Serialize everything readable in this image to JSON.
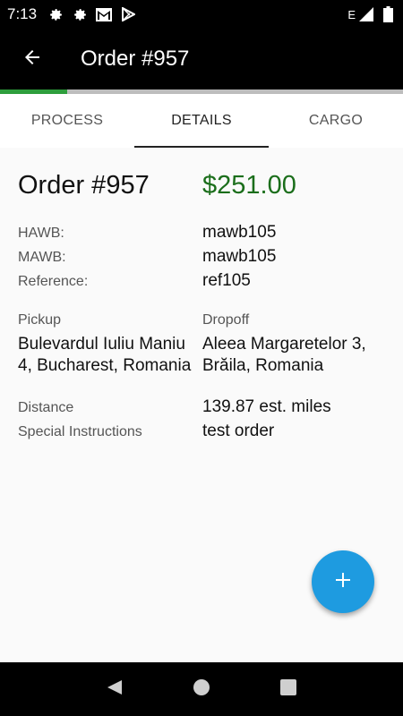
{
  "status_bar": {
    "time": "7:13",
    "network_label": "E",
    "icons": [
      "settings-icon",
      "settings-icon",
      "gmail-icon",
      "play-store-icon",
      "signal-icon",
      "battery-icon"
    ]
  },
  "app_bar": {
    "title": "Order #957",
    "back_icon": "arrow-left-icon"
  },
  "progress": {
    "fraction": 0.167,
    "color": "#2e9e3c"
  },
  "tabs": [
    {
      "label": "PROCESS",
      "active": false
    },
    {
      "label": "DETAILS",
      "active": true
    },
    {
      "label": "CARGO",
      "active": false
    }
  ],
  "order": {
    "number": "Order #957",
    "price": "$251.00",
    "price_color": "#1b6e1b"
  },
  "details": {
    "hawb_label": "HAWB:",
    "hawb_value": "mawb105",
    "mawb_label": "MAWB:",
    "mawb_value": "mawb105",
    "reference_label": "Reference:",
    "reference_value": "ref105",
    "pickup_label": "Pickup",
    "pickup_value": "Bulevardul Iuliu Maniu 4, Bucharest, Romania",
    "dropoff_label": "Dropoff",
    "dropoff_value": "Aleea Margaretelor 3, Brăila, Romania",
    "distance_label": "Distance",
    "distance_value": "139.87 est. miles",
    "special_label": "Special Instructions",
    "special_value": "test order"
  },
  "fab": {
    "icon": "plus-icon",
    "color": "#1e9be0"
  },
  "nav_bar": {
    "icons": [
      "back-triangle-icon",
      "home-circle-icon",
      "recents-square-icon"
    ]
  }
}
